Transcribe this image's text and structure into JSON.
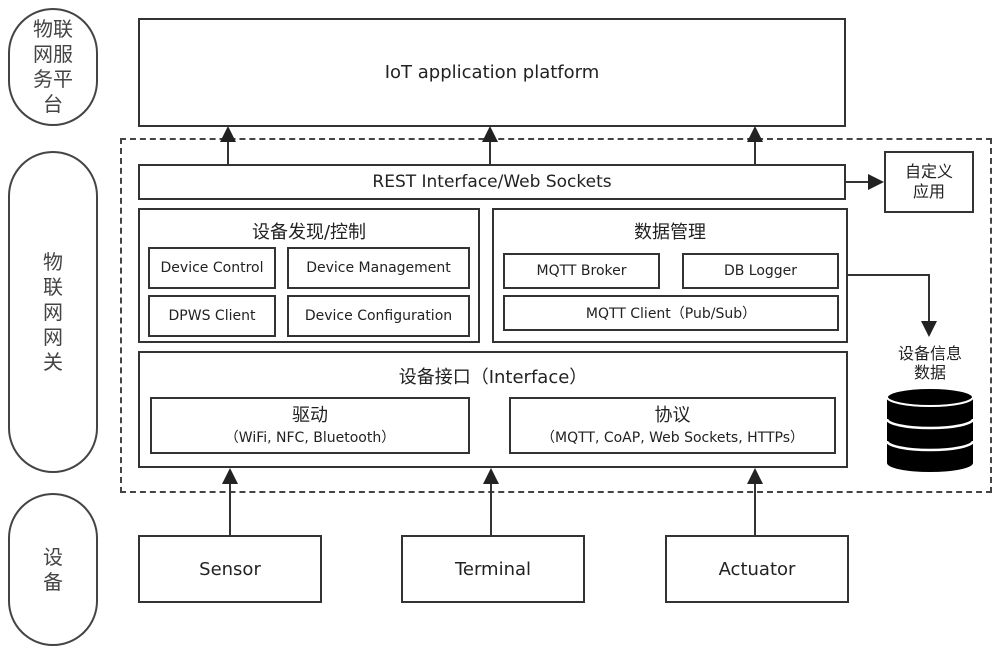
{
  "layers": {
    "platform": "物联\n网服\n务平\n台",
    "gateway": "物\n联\n网\n网\n关",
    "devices": "设\n备"
  },
  "platform": {
    "title": "IoT application platform"
  },
  "rest": {
    "title": "REST Interface/Web Sockets"
  },
  "custom_app": {
    "title": "自定义\n应用"
  },
  "discovery": {
    "title": "设备发现/控制",
    "items": [
      "Device Control",
      "Device Management",
      "DPWS Client",
      "Device Configuration"
    ]
  },
  "data_mgmt": {
    "title": "数据管理",
    "items": [
      "MQTT Broker",
      "DB Logger",
      "MQTT Client（Pub/Sub）"
    ]
  },
  "device_info": {
    "title": "设备信息\n数据"
  },
  "interface": {
    "title": "设备接口（Interface）",
    "driver": {
      "title": "驱动",
      "sub": "（WiFi, NFC,  Bluetooth）"
    },
    "protocol": {
      "title": "协议",
      "sub": "（MQTT, CoAP, Web Sockets, HTTPs）"
    }
  },
  "devices": [
    "Sensor",
    "Terminal",
    "Actuator"
  ]
}
